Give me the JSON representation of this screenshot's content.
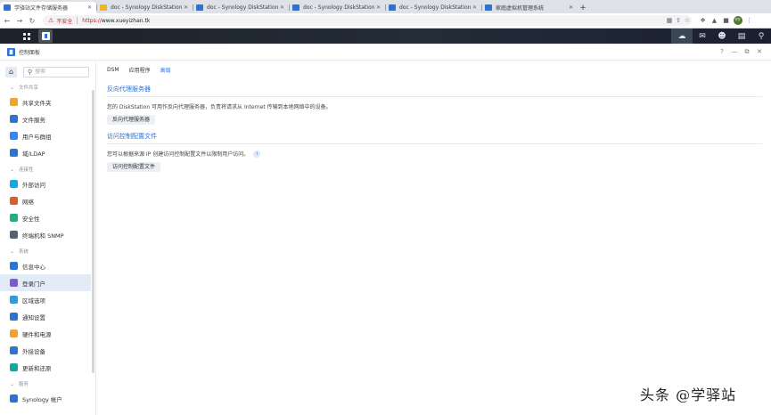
{
  "browser": {
    "tabs": [
      {
        "title": "学驿站文件存储服务器",
        "active": true,
        "favicon_color": "#2d72d6"
      },
      {
        "title": "doc - Synology DiskStation",
        "active": false,
        "favicon_color": "#f0b429"
      },
      {
        "title": "doc - Synology DiskStation",
        "active": false,
        "favicon_color": "#2d72d6"
      },
      {
        "title": "doc - Synology DiskStation",
        "active": false,
        "favicon_color": "#2d72d6"
      },
      {
        "title": "doc - Synology DiskStation",
        "active": false,
        "favicon_color": "#2d72d6"
      },
      {
        "title": "家庭虚拟机管理系统",
        "active": false,
        "favicon_color": "#2d72d6"
      }
    ],
    "address": {
      "security_label": "不安全",
      "protocol": "https://",
      "host": "www.xueyizhan.tk"
    },
    "avatar_initials": "YY"
  },
  "window": {
    "title": "控制面板",
    "controls": [
      "?",
      "—",
      "⧉",
      "✕"
    ]
  },
  "sidebar": {
    "search_placeholder": "搜索",
    "sections": [
      {
        "label": "文件共享",
        "items": [
          {
            "label": "共享文件夹",
            "color": "#f0a32e"
          },
          {
            "label": "文件服务",
            "color": "#2d72d6"
          },
          {
            "label": "用户与群组",
            "color": "#3b82f6"
          },
          {
            "label": "域/LDAP",
            "color": "#2d72d6"
          }
        ]
      },
      {
        "label": "连接性",
        "items": [
          {
            "label": "外部访问",
            "color": "#1aa6e0"
          },
          {
            "label": "网络",
            "color": "#e05a2b"
          },
          {
            "label": "安全性",
            "color": "#22b07d"
          },
          {
            "label": "终端机和 SNMP",
            "color": "#556270"
          }
        ]
      },
      {
        "label": "系统",
        "items": [
          {
            "label": "信息中心",
            "color": "#2d72d6"
          },
          {
            "label": "登录门户",
            "color": "#7a5bd6",
            "selected": true
          },
          {
            "label": "区域选项",
            "color": "#2d9cdb"
          },
          {
            "label": "通知设置",
            "color": "#2d72d6"
          },
          {
            "label": "硬件和电源",
            "color": "#f0a32e"
          },
          {
            "label": "外接设备",
            "color": "#2d72d6"
          },
          {
            "label": "更新和还原",
            "color": "#1aa6a0"
          }
        ]
      },
      {
        "label": "服务",
        "items": [
          {
            "label": "Synology 帐户",
            "color": "#2d72d6"
          }
        ]
      }
    ]
  },
  "content": {
    "tabs": [
      {
        "label": "DSM",
        "active": false
      },
      {
        "label": "应用程序",
        "active": false
      },
      {
        "label": "高级",
        "active": true
      }
    ],
    "reverse_proxy": {
      "heading": "反向代理服务器",
      "description": "您的 DiskStation 可用作反向代理服务器，负责将请求从 Internet 传输到本地网络中的设备。",
      "button": "反向代理服务器"
    },
    "access_control": {
      "heading": "访问控制配置文件",
      "description": "您可以根据来源 IP 创建访问控制配置文件以限制用户访问。",
      "button": "访问控制配置文件"
    }
  },
  "watermark": "头条 @学驿站"
}
